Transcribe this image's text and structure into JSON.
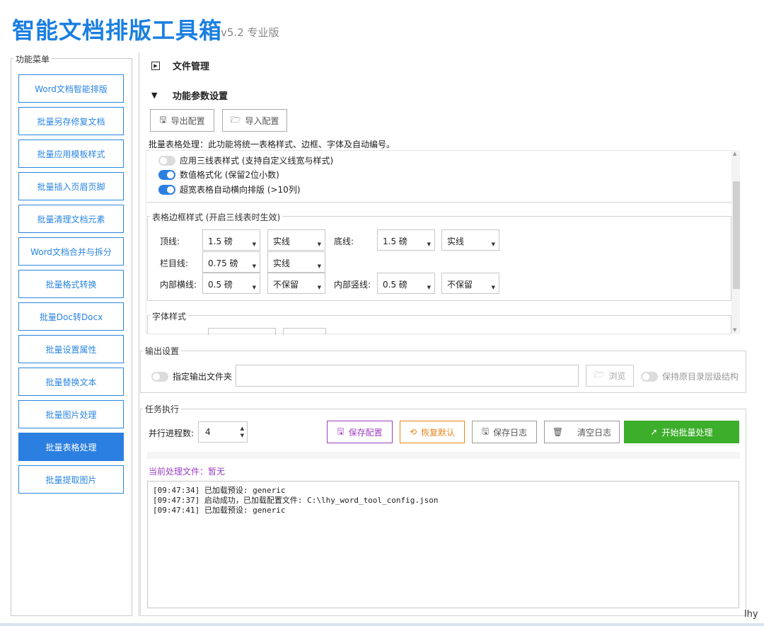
{
  "app": {
    "title": "智能文档排版工具箱",
    "version": "v5.2 专业版",
    "author": "lhy"
  },
  "sidebar": {
    "legend": "功能菜单",
    "items": [
      {
        "label": "Word文档智能排版"
      },
      {
        "label": "批量另存修复文档"
      },
      {
        "label": "批量应用模板样式"
      },
      {
        "label": "批量插入页眉页脚"
      },
      {
        "label": "批量清理文档元素"
      },
      {
        "label": "Word文档合并与拆分"
      },
      {
        "label": "批量格式转换"
      },
      {
        "label": "批量Doc转Docx"
      },
      {
        "label": "批量设置属性"
      },
      {
        "label": "批量替换文本"
      },
      {
        "label": "批量图片处理"
      },
      {
        "label": "批量表格处理",
        "active": true
      },
      {
        "label": "批量提取图片"
      }
    ]
  },
  "sections": {
    "file_mgmt": "文件管理",
    "params": "功能参数设置"
  },
  "config_buttons": {
    "export": "导出配置",
    "import": "导入配置"
  },
  "table_processing": {
    "description": "批量表格处理：此功能将统一表格样式、边框、字体及自动编号。",
    "options": [
      {
        "label": "应用三线表样式 (支持自定义线宽与样式)",
        "on": false
      },
      {
        "label": "数值格式化 (保留2位小数)",
        "on": true
      },
      {
        "label": "超宽表格自动横向排版 (>10列)",
        "on": true
      }
    ]
  },
  "border_style": {
    "legend": "表格边框样式 (开启三线表时生效)",
    "top_label": "顶线:",
    "top_width": "1.5 磅",
    "top_style": "实线",
    "bottom_label": "底线:",
    "bottom_width": "1.5 磅",
    "bottom_style": "实线",
    "header_label": "栏目线:",
    "header_width": "0.75 磅",
    "header_style": "实线",
    "inner_h_label": "内部横线:",
    "inner_h_width": "0.5 磅",
    "inner_h_style": "不保留",
    "inner_v_label": "内部竖线:",
    "inner_v_width": "0.5 磅",
    "inner_v_style": "不保留"
  },
  "font_style": {
    "legend": "字体样式"
  },
  "output": {
    "legend": "输出设置",
    "specify_folder_label": "指定输出文件夹",
    "specify_folder_on": false,
    "folder_value": "",
    "browse": "浏览",
    "keep_structure_label": "保持原目录层级结构",
    "keep_structure_on": false
  },
  "task": {
    "legend": "任务执行",
    "parallel_label": "并行进程数:",
    "parallel_value": "4",
    "save_config": "保存配置",
    "restore_default": "恢复默认",
    "save_log": "保存日志",
    "clear_log": "清空日志",
    "start": "开始批量处理",
    "progress": 0,
    "current_file": "当前处理文件：暂无",
    "log": [
      "[09:47:34] 已加载预设: generic",
      "[09:47:37] 启动成功，已加载配置文件: C:\\lhy_word_tool_config.json",
      "[09:47:41] 已加载预设: generic"
    ]
  },
  "colors": {
    "accent": "#2b7fe0",
    "start_button": "#3dae2b",
    "save_config": "#9b3fc2",
    "restore_default": "#e8851c"
  }
}
